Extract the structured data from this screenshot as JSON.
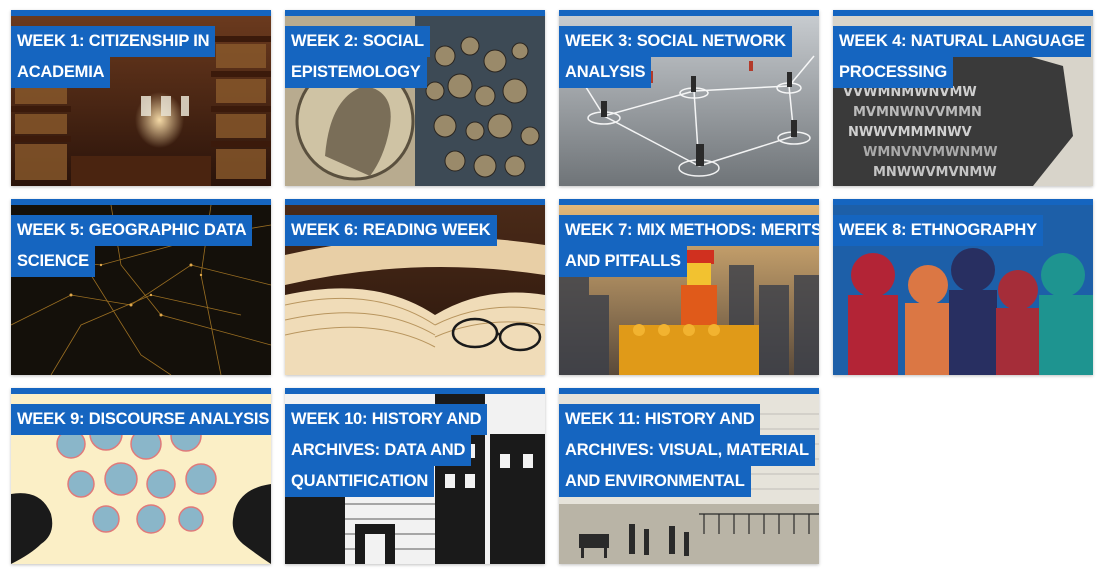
{
  "accent_color": "#1565c0",
  "tiles": [
    {
      "lines": [
        "WEEK 1: CITIZENSHIP IN",
        "ACADEMIA"
      ],
      "image": "library-interior"
    },
    {
      "lines": [
        "WEEK 2: SOCIAL",
        "EPISTEMOLOGY"
      ],
      "image": "surreal-portrait"
    },
    {
      "lines": [
        "WEEK 3: SOCIAL NETWORK",
        "ANALYSIS"
      ],
      "image": "network-figures"
    },
    {
      "lines": [
        "WEEK 4: NATURAL LANGUAGE",
        "PROCESSING"
      ],
      "image": "letter-sculpture"
    },
    {
      "lines": [
        "WEEK 5: GEOGRAPHIC DATA",
        "SCIENCE"
      ],
      "image": "city-lights-at-night"
    },
    {
      "lines": [
        "WEEK 6: READING WEEK"
      ],
      "image": "open-books-and-glasses"
    },
    {
      "lines": [
        "WEEK 7: MIX METHODS: MERITS",
        "AND PITFALLS"
      ],
      "image": "lego-construction-worker"
    },
    {
      "lines": [
        "WEEK 8: ETHNOGRAPHY"
      ],
      "image": "colorful-silhouettes"
    },
    {
      "lines": [
        "WEEK 9: DISCOURSE ANALYSIS"
      ],
      "image": "speech-bubble-heads"
    },
    {
      "lines": [
        "WEEK 10: HISTORY AND",
        "ARCHIVES: DATA AND",
        "QUANTIFICATION"
      ],
      "image": "old-street-engraving"
    },
    {
      "lines": [
        "WEEK 11: HISTORY AND",
        "ARCHIVES: VISUAL, MATERIAL",
        "AND ENVIRONMENTAL"
      ],
      "image": "old-park-engraving"
    }
  ]
}
